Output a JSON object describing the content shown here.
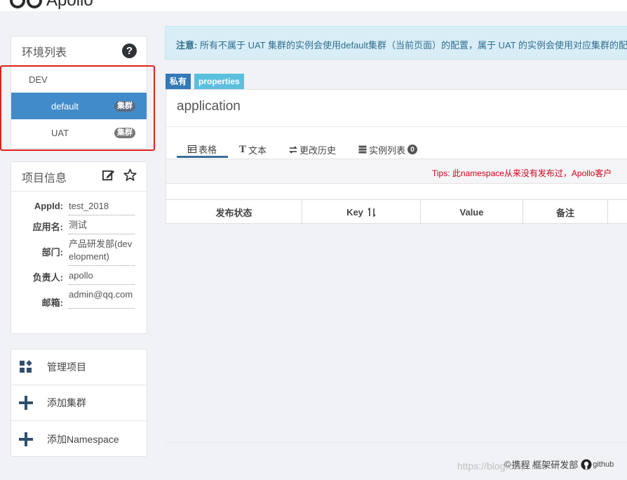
{
  "app": {
    "logo_text": "Apollo"
  },
  "env_panel": {
    "title": "环境列表",
    "env_name": "DEV",
    "clusters": [
      {
        "name": "default",
        "badge": "集群"
      },
      {
        "name": "UAT",
        "badge": "集群"
      }
    ]
  },
  "project_info": {
    "title": "项目信息",
    "rows": [
      {
        "key": "AppId:",
        "value": "test_2018"
      },
      {
        "key": "应用名:",
        "value": "测试"
      },
      {
        "key": "部门:",
        "value": "产品研发部(development)"
      },
      {
        "key": "负责人:",
        "value": "apollo"
      },
      {
        "key": "邮箱:",
        "value": "admin@qq.com"
      }
    ]
  },
  "actions": {
    "manage_project": "管理项目",
    "add_cluster": "添加集群",
    "add_namespace": "添加Namespace"
  },
  "notice": {
    "label": "注意:",
    "text": "所有不属于 UAT 集群的实例会使用default集群（当前页面）的配置，属于 UAT 的实例会使用对应集群的配"
  },
  "namespace": {
    "scope_label": "私有",
    "format_label": "properties",
    "name": "application",
    "tabs": {
      "table": "表格",
      "text": "文本",
      "history": "更改历史",
      "instances": "实例列表",
      "instance_count": "0"
    },
    "tips": "Tips: 此namespace从来没有发布过，Apollo客户",
    "columns": [
      "发布状态",
      "Key",
      "Value",
      "备注"
    ]
  },
  "footer": {
    "text": "携程 框架研发部",
    "github": "github"
  },
  "watermark": "https://blog.csdn.net"
}
